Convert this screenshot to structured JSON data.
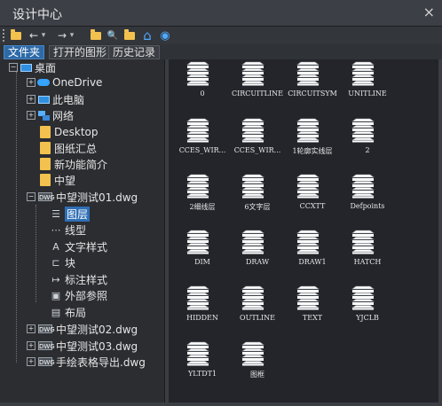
{
  "window": {
    "title": "设计中心",
    "close_glyph": "×"
  },
  "toolbar": {
    "buttons": [
      {
        "name": "load-folder-icon"
      },
      {
        "name": "back-arrow-icon",
        "glyph": "←"
      },
      {
        "name": "back-dropdown-icon",
        "glyph": "▾"
      },
      {
        "name": "forward-arrow-icon",
        "glyph": "→"
      },
      {
        "name": "forward-dropdown-icon",
        "glyph": "▾"
      },
      {
        "name": "up-folder-icon"
      },
      {
        "name": "search-icon",
        "glyph": "🔍"
      },
      {
        "name": "favorites-folder-icon"
      },
      {
        "name": "home-icon",
        "glyph": "⌂"
      },
      {
        "name": "preview-eye-icon",
        "glyph": "◉"
      }
    ]
  },
  "tabs": [
    {
      "label": "文件夹",
      "active": true
    },
    {
      "label": "打开的图形",
      "active": false
    },
    {
      "label": "历史记录",
      "active": false
    }
  ],
  "tree": {
    "desktop": "桌面",
    "onedrive": "OneDrive",
    "this_pc": "此电脑",
    "network": "网络",
    "desktop_folder": "Desktop",
    "drawing_summary": "图纸汇总",
    "new_features": "新功能简介",
    "zwsoft": "中望",
    "dwg1": "中望测试01.dwg",
    "dwg1_dwg_tag": "DWG",
    "dwg1_children": {
      "layers": "图层",
      "linetypes": "线型",
      "text_styles": "文字样式",
      "blocks": "块",
      "dim_styles": "标注样式",
      "xrefs": "外部参照",
      "layouts": "布局"
    },
    "dwg2": "中望测试02.dwg",
    "dwg3": "中望测试03.dwg",
    "dwg4": "手绘表格导出.dwg"
  },
  "layers": [
    "0",
    "CIRCUITLINE",
    "CIRCUITSYM",
    "UNITLINE",
    "CCES_WIR...",
    "CCES_WIR...",
    "1轮廓实线层",
    "2",
    "2细线层",
    "6文字层",
    "CCXTT",
    "Defpoints",
    "DIM",
    "DRAW",
    "DRAW1",
    "HATCH",
    "HIDDEN",
    "OUTLINE",
    "TEXT",
    "YJCLB",
    "YLTDT1",
    "图框"
  ]
}
